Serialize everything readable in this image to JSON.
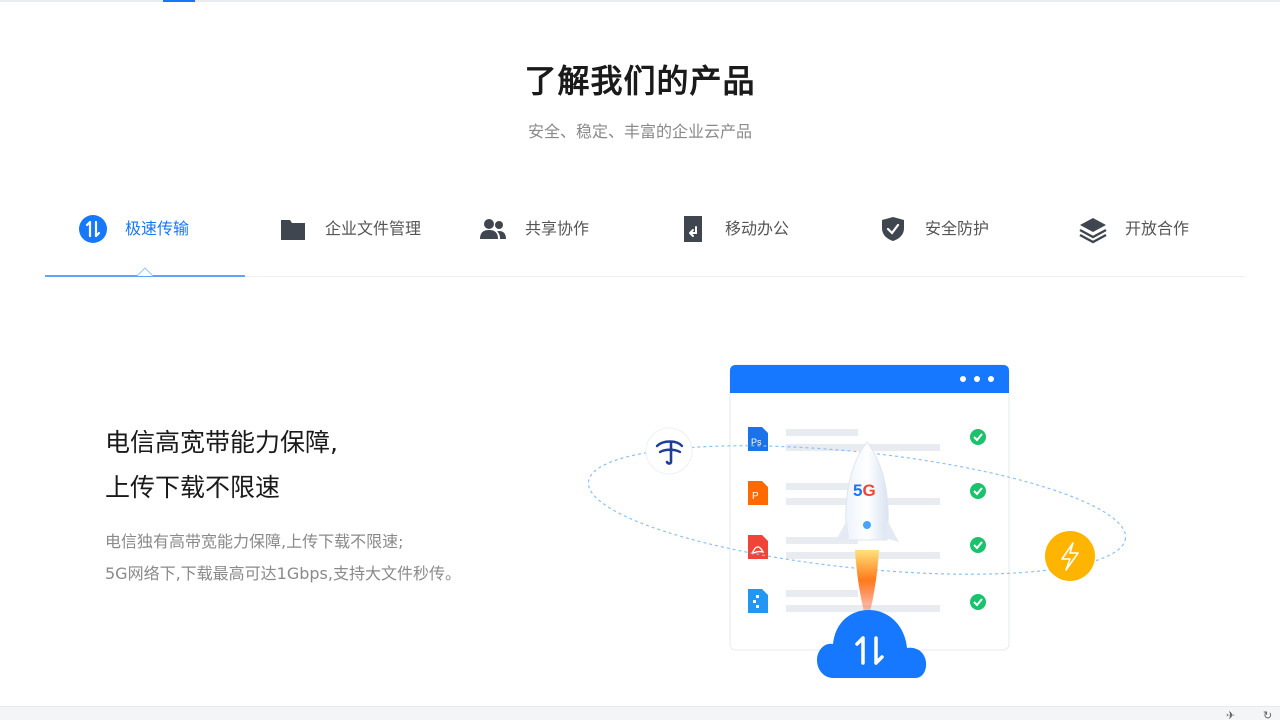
{
  "header": {
    "title": "了解我们的产品",
    "subtitle": "安全、稳定、丰富的企业云产品"
  },
  "tabs": [
    {
      "label": "极速传输",
      "icon": "transfer-icon",
      "active": true
    },
    {
      "label": "企业文件管理",
      "icon": "folder-icon",
      "active": false
    },
    {
      "label": "共享协作",
      "icon": "users-icon",
      "active": false
    },
    {
      "label": "移动办公",
      "icon": "mobile-icon",
      "active": false
    },
    {
      "label": "安全防护",
      "icon": "shield-icon",
      "active": false
    },
    {
      "label": "开放合作",
      "icon": "layers-icon",
      "active": false
    }
  ],
  "feature": {
    "title_line1": "电信高宽带能力保障,",
    "title_line2": "上传下载不限速",
    "desc_line1": "电信独有高带宽能力保障,上传下载不限速;",
    "desc_line2": "5G网络下,下载最高可达1Gbps,支持大文件秒传。"
  },
  "illustration": {
    "badge": "5G",
    "files": [
      {
        "type": "Ps",
        "color": "#1a73e8"
      },
      {
        "type": "P",
        "color": "#ff6a00"
      },
      {
        "type": "pdf",
        "color": "#f04438"
      },
      {
        "type": "zip",
        "color": "#2196f3"
      }
    ]
  },
  "colors": {
    "accent": "#1677ff",
    "check": "#19c26b",
    "bolt": "#ffb400"
  }
}
